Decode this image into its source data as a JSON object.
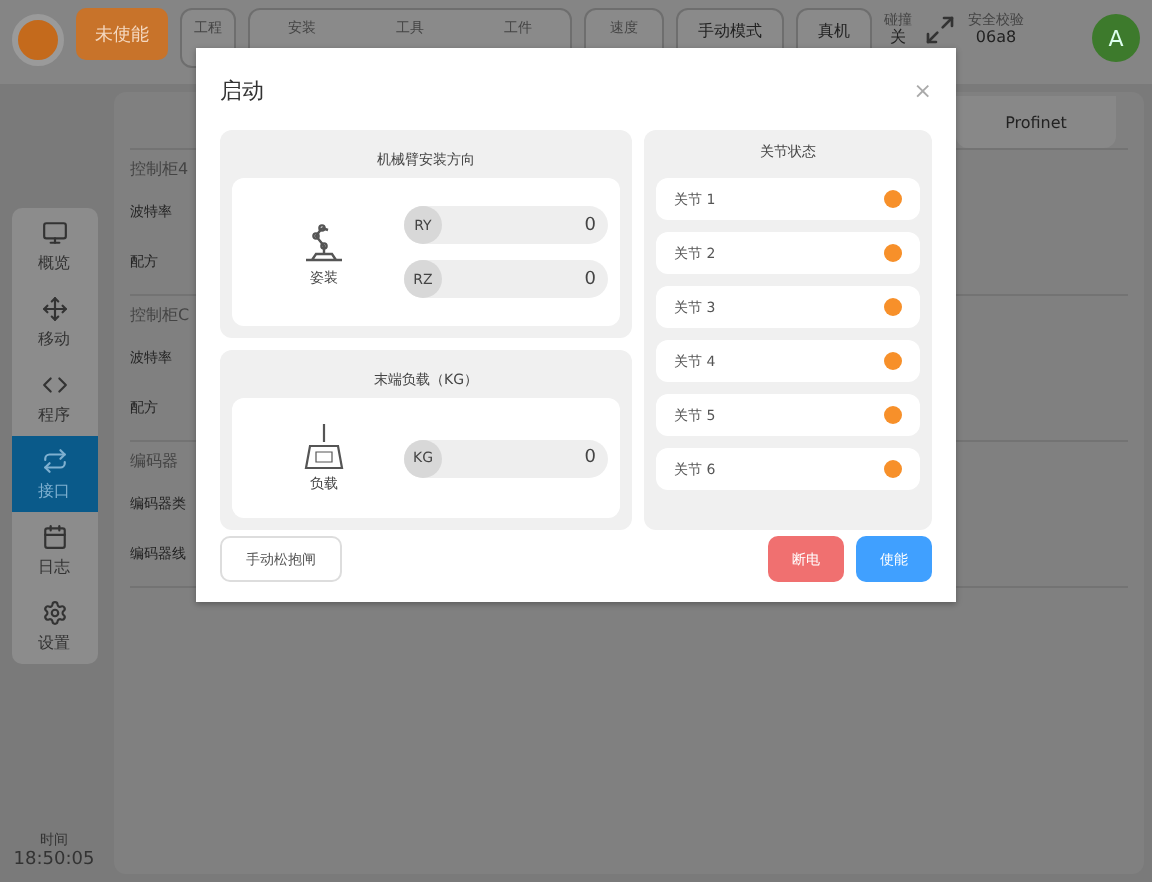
{
  "top_bar": {
    "enable_button": "未使能",
    "project": {
      "label": "工程"
    },
    "setup": [
      {
        "label": "安装"
      },
      {
        "label": "工具"
      },
      {
        "label": "工件"
      }
    ],
    "speed": {
      "label": "速度"
    },
    "mode_button": "手动模式",
    "machine_button": "真机",
    "collision": {
      "label": "碰撞",
      "value": "关"
    },
    "safety": {
      "label": "安全校验",
      "value": "06a8"
    },
    "avatar": "A"
  },
  "sidebar": {
    "items": [
      {
        "label": "概览",
        "selected": false
      },
      {
        "label": "移动",
        "selected": false
      },
      {
        "label": "程序",
        "selected": false
      },
      {
        "label": "接口",
        "selected": true
      },
      {
        "label": "日志",
        "selected": false
      },
      {
        "label": "设置",
        "selected": false
      }
    ],
    "time": {
      "label": "时间",
      "value": "18:50:05"
    }
  },
  "background": {
    "tab": "Profinet",
    "sections": [
      {
        "title": "控制柜4",
        "rows": [
          "波特率",
          "配方"
        ]
      },
      {
        "title": "控制柜C",
        "rows": [
          "波特率",
          "配方"
        ]
      },
      {
        "title": "编码器",
        "rows": [
          "编码器类",
          "编码器线"
        ]
      }
    ]
  },
  "dialog": {
    "title": "启动",
    "close": "×",
    "mount": {
      "title": "机械臂安装方向",
      "icon_label": "姿装",
      "fields": [
        {
          "label": "RY",
          "value": "0"
        },
        {
          "label": "RZ",
          "value": "0"
        }
      ]
    },
    "payload": {
      "title": "末端负载（KG）",
      "icon_label": "负载",
      "fields": [
        {
          "label": "KG",
          "value": "0"
        }
      ]
    },
    "joints": {
      "title": "关节状态",
      "items": [
        {
          "label": "关节 1",
          "color": "#f7902a"
        },
        {
          "label": "关节 2",
          "color": "#f7902a"
        },
        {
          "label": "关节 3",
          "color": "#f7902a"
        },
        {
          "label": "关节 4",
          "color": "#f7902a"
        },
        {
          "label": "关节 5",
          "color": "#f7902a"
        },
        {
          "label": "关节 6",
          "color": "#f7902a"
        }
      ]
    },
    "brake_button": "手动松抱闸",
    "power_off_button": "断电",
    "enable_button": "使能"
  }
}
